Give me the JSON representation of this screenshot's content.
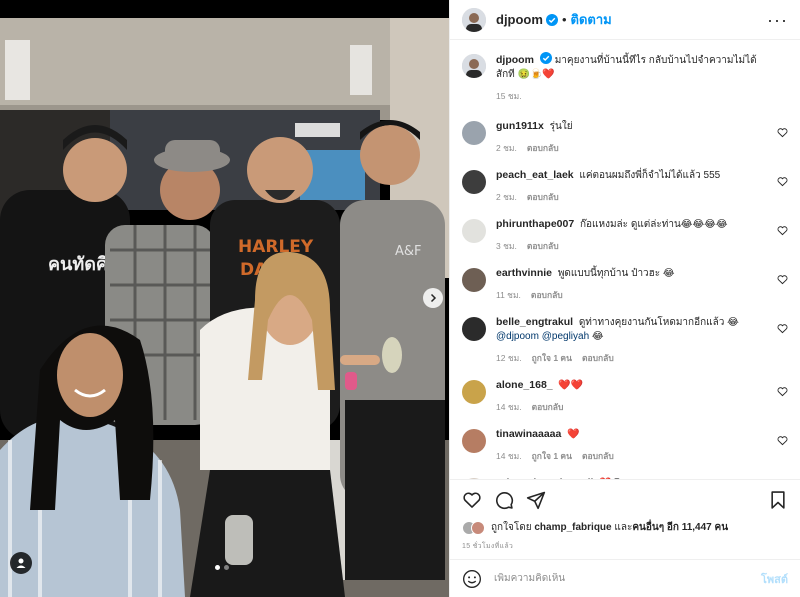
{
  "header": {
    "username": "djpoom",
    "separator": "•",
    "follow_label": "ติดตาม",
    "more_label": "···"
  },
  "caption": {
    "username": "djpoom",
    "text": "มาคุยงานที่บ้านนี้ทีไร กลับบ้านไปจำความไม่ได้สักที 🤢🍺❤️",
    "time": "15 ชม."
  },
  "comments": [
    {
      "username": "gun1911x",
      "text": "รุ่นใย่",
      "time": "2 ชม.",
      "likes": "",
      "reply": "ตอบกลับ"
    },
    {
      "username": "peach_eat_laek",
      "text": "แค่ตอนผมถึงพี่ก็จำไม่ได้แล้ว 555",
      "time": "2 ชม.",
      "likes": "",
      "reply": "ตอบกลับ"
    },
    {
      "username": "phirunthape007",
      "text": "ก๊อแหงมล่ะ ดูแต่ล่ะท่าน😂😂😂😂",
      "time": "3 ชม.",
      "likes": "",
      "reply": "ตอบกลับ"
    },
    {
      "username": "earthvinnie",
      "text": "พูดแบบนี้ทุกบ้าน ป๋าวฮะ 😂",
      "time": "11 ชม.",
      "likes": "",
      "reply": "ตอบกลับ"
    },
    {
      "username": "belle_engtrakul",
      "text": "ดูท่าทางคุยงานกันโหดมากอีกแล้ว 😂",
      "mentions": "@djpoom @pegliyah",
      "mentions_emoji": "😂",
      "time": "12 ชม.",
      "likes": "ถูกใจ 1 คน",
      "reply": "ตอบกลับ"
    },
    {
      "username": "alone_168_",
      "text": "❤️❤️",
      "time": "14 ชม.",
      "likes": "",
      "reply": "ตอบกลับ"
    },
    {
      "username": "tinawinaaaaa",
      "text": "❤️",
      "time": "14 ชม.",
      "likes": "ถูกใจ 1 คน",
      "reply": "ตอบกลับ"
    },
    {
      "username": "priyaaphrnethaasrii",
      "text": "❤️😱",
      "time": "",
      "likes": "",
      "reply": ""
    }
  ],
  "likes": {
    "prefix": "ถูกใจโดย",
    "user": "champ_fabrique",
    "middle": "และ",
    "others": "คนอื่นๆ อีก 11,447 คน"
  },
  "time_ago": "15 ชั่วโมงที่แล้ว",
  "comment_box": {
    "placeholder": "เพิ่มความคิดเห็น",
    "post_label": "โพสต์"
  },
  "colors": {
    "accent": "#0095f6",
    "heart": "#ed4956",
    "muted": "#8e8e8e"
  },
  "icons": [
    "verified-icon",
    "heart-icon",
    "comment-icon",
    "share-icon",
    "bookmark-icon",
    "emoji-icon",
    "tag-user-icon",
    "next-arrow-icon"
  ]
}
